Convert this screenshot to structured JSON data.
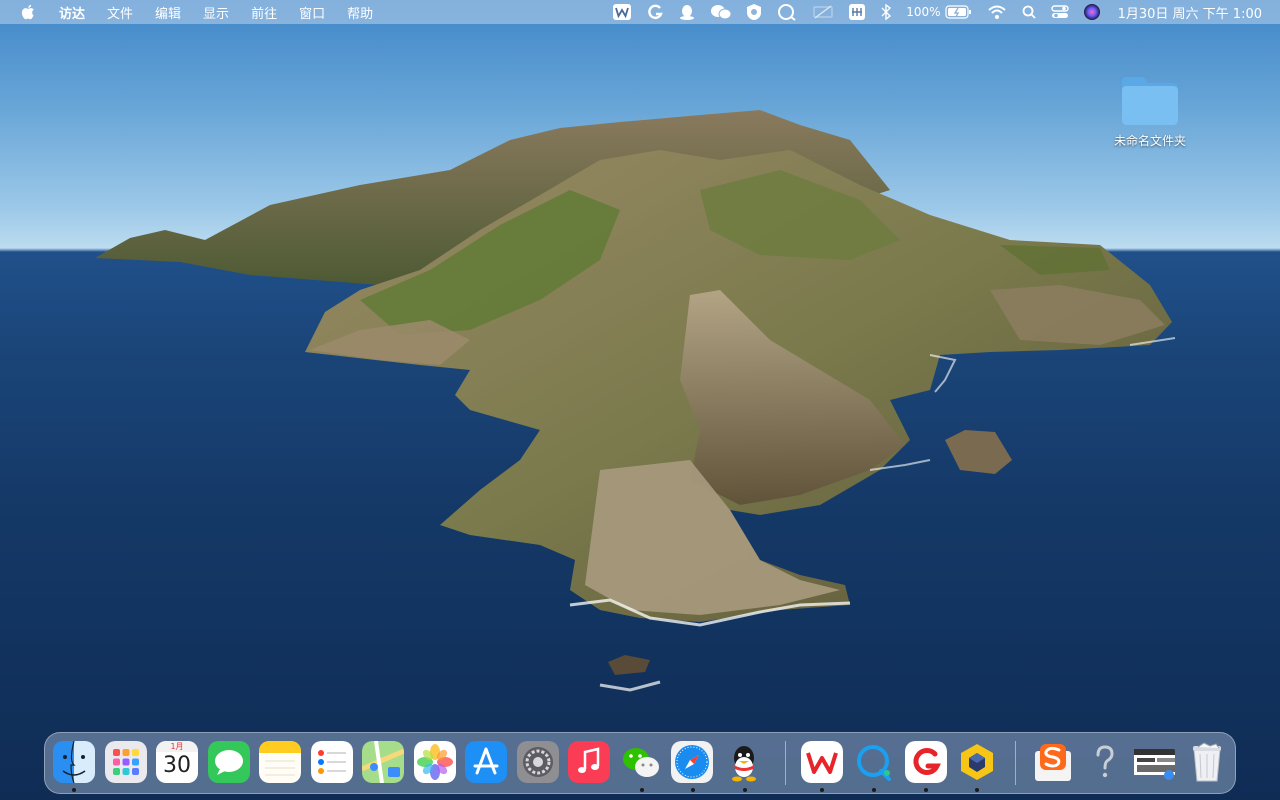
{
  "menubar": {
    "app_name": "访达",
    "items": [
      "文件",
      "编辑",
      "显示",
      "前往",
      "窗口",
      "帮助"
    ],
    "battery_percent": "100%",
    "clock": "1月30日 周六 下午 1:00"
  },
  "tray_icons": [
    "wps-icon",
    "grammarly-icon",
    "qq-penguin-icon",
    "wechat-icon",
    "shield-icon",
    "chat-bubble-icon",
    "screen-mirror-icon",
    "pinyin-input-icon",
    "bluetooth-icon",
    "battery-icon",
    "wifi-icon",
    "search-icon",
    "control-center-icon",
    "siri-icon"
  ],
  "desktop": {
    "folder_label": "未命名文件夹"
  },
  "dock": {
    "calendar_month": "1月",
    "calendar_day": "30",
    "apps": [
      "finder",
      "launchpad",
      "calendar",
      "messages",
      "notes",
      "reminders",
      "maps",
      "photos",
      "app-store",
      "system-preferences",
      "music",
      "wechat",
      "safari",
      "qq",
      "wps",
      "qq-browser",
      "grammarly",
      "box",
      "sogou-pinyin",
      "help",
      "screenshot",
      "trash"
    ]
  }
}
